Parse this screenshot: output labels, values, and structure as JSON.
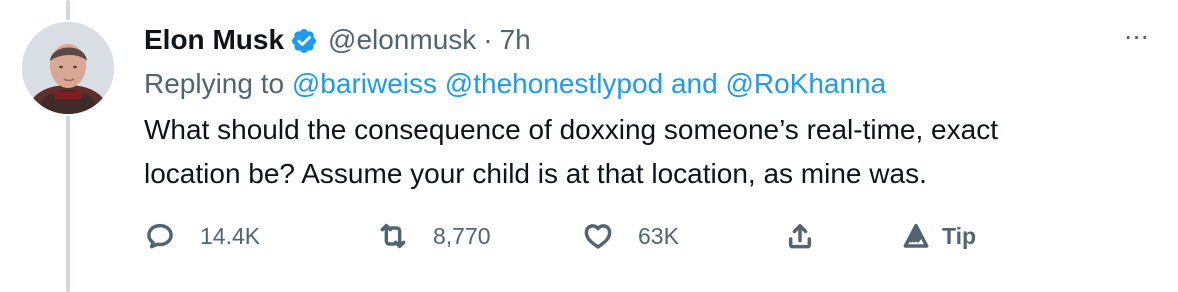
{
  "tweet": {
    "author_name": "Elon Musk",
    "author_handle": "@elonmusk",
    "separator": "·",
    "time": "7h",
    "reply_prefix": "Replying to",
    "reply_mentions": [
      "@bariweiss",
      "@thehonestlypod"
    ],
    "reply_and": "and",
    "reply_last_mention": "@RoKhanna",
    "text_line_1": "What should the consequence of doxxing someone’s real-time, exact",
    "text_line_2": "location be? Assume your child is at that location, as mine was.",
    "more_label": "···"
  },
  "actions": {
    "reply_count": "14.4K",
    "retweet_count": "8,770",
    "like_count": "63K",
    "tip_label": "Tip"
  },
  "icons": {
    "avatar": "profile-photo",
    "verified": "verified-badge-icon",
    "reply": "reply-icon",
    "retweet": "retweet-icon",
    "like": "heart-icon",
    "share": "share-icon",
    "tip": "tip-icon",
    "more": "more-icon"
  },
  "colors": {
    "accent": "#1d9bf0",
    "text": "#0f1419",
    "muted": "#536471",
    "thread_line": "#cfd9de"
  }
}
